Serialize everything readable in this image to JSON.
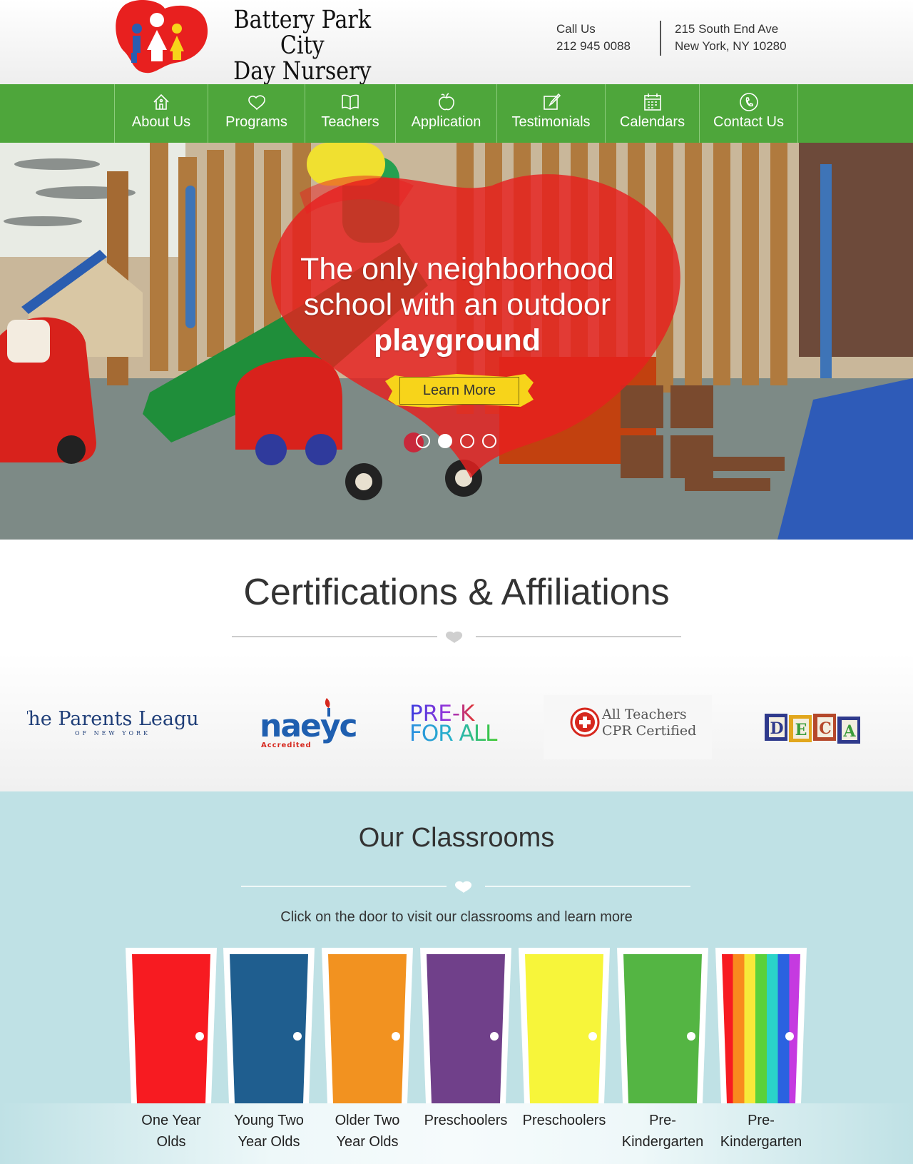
{
  "header": {
    "logo_line1": "Battery Park City",
    "logo_line2": "Day Nursery",
    "call_label": "Call Us",
    "phone": "212 945 0088",
    "address_line1": "215 South End Ave",
    "address_line2": "New York, NY 10280"
  },
  "nav": {
    "items": [
      {
        "label": "About Us",
        "icon": "house-icon"
      },
      {
        "label": "Programs",
        "icon": "heart-icon"
      },
      {
        "label": "Teachers",
        "icon": "book-icon"
      },
      {
        "label": "Application",
        "icon": "apple-icon"
      },
      {
        "label": "Testimonials",
        "icon": "edit-icon"
      },
      {
        "label": "Calendars",
        "icon": "calendar-icon"
      },
      {
        "label": "Contact Us",
        "icon": "phone-icon"
      }
    ]
  },
  "hero": {
    "line1": "The only neighborhood",
    "line2": "school with an outdoor",
    "line3": "playground",
    "button": "Learn More",
    "slides": 4,
    "active_slide": 2
  },
  "certifications": {
    "title": "Certifications & Affiliations",
    "logos": {
      "parents_league": "The Parents League",
      "parents_league_sub": "OF NEW YORK",
      "naeyc": "naeyc",
      "naeyc_sub": "Accredited",
      "prek_top": "PRE-K",
      "prek_bottom": "FOR ALL",
      "cpr_line1": "All Teachers",
      "cpr_line2": "CPR Certified",
      "deca": [
        "D",
        "E",
        "C",
        "A"
      ]
    }
  },
  "classrooms": {
    "title": "Our Classrooms",
    "subtitle": "Click on the door to visit our classrooms and learn more",
    "doors": [
      {
        "line1": "One Year",
        "line2": "Olds",
        "color": "#f71b21"
      },
      {
        "line1": "Young Two",
        "line2": "Year Olds",
        "color": "#1f5e8f"
      },
      {
        "line1": "Older Two",
        "line2": "Year Olds",
        "color": "#f29220"
      },
      {
        "line1": "Preschoolers",
        "line2": "",
        "color": "#70408a"
      },
      {
        "line1": "Preschoolers",
        "line2": "",
        "color": "#f7f53a"
      },
      {
        "line1": "Pre-",
        "line2": "Kindergarten",
        "color": "#54b543"
      },
      {
        "line1": "Pre-",
        "line2": "Kindergarten",
        "color": "rainbow"
      }
    ]
  },
  "colors": {
    "nav_green": "#4ea63b",
    "heart_red": "#e8201f",
    "button_yellow": "#f7d41a",
    "classroom_bg": "#bfe1e5"
  }
}
